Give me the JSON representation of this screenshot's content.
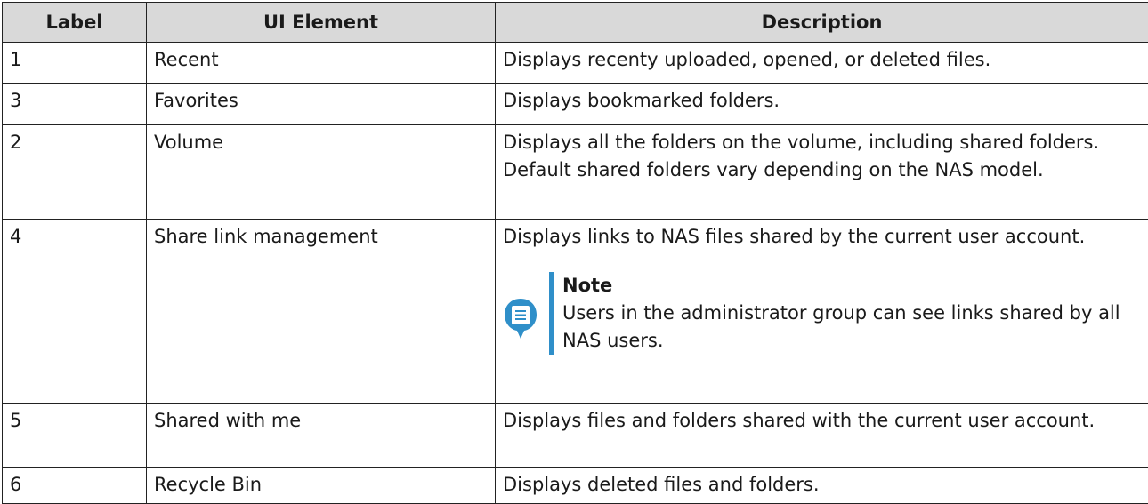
{
  "table": {
    "headers": [
      "Label",
      "UI Element",
      "Description"
    ],
    "rows": [
      {
        "label": "1",
        "element": "Recent",
        "description": "Displays recenty uploaded, opened, or deleted files."
      },
      {
        "label": "3",
        "element": "Favorites",
        "description": "Displays bookmarked folders."
      },
      {
        "label": "2",
        "element": "Volume",
        "description": "Displays all the folders on the volume, including shared folders. Default shared folders vary depending on the NAS model."
      },
      {
        "label": "4",
        "element": "Share link management",
        "description": "Displays links to NAS files shared by the current user account.",
        "note": {
          "title": "Note",
          "text": "Users in the administrator group can see links shared by all NAS users.",
          "icon": "note-icon"
        }
      },
      {
        "label": "5",
        "element": "Shared with me",
        "description": "Displays files and folders shared with the current user account."
      },
      {
        "label": "6",
        "element": "Recycle Bin",
        "description": "Displays deleted files and folders."
      }
    ]
  },
  "colors": {
    "header_bg": "#d9d9d9",
    "note_accent": "#2f8fc9",
    "border": "#222222"
  }
}
